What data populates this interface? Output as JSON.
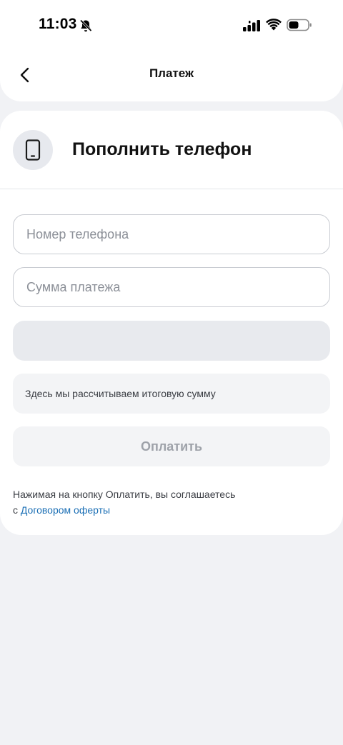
{
  "status_bar": {
    "time": "11:03",
    "icons": [
      "bell-off-icon",
      "signal-icon",
      "wifi-icon",
      "battery-icon"
    ]
  },
  "nav": {
    "back_icon": "chevron-left-icon",
    "title": "Платеж"
  },
  "header": {
    "icon": "smartphone-icon",
    "title": "Пополнить телефон"
  },
  "form": {
    "phone_placeholder": "Номер телефона",
    "phone_value": "",
    "amount_placeholder": "Сумма платежа",
    "amount_value": "",
    "summary_text": "Здесь мы рассчитываем итоговую сумму",
    "pay_label": "Оплатить"
  },
  "terms": {
    "text_line1": "Нажимая на кнопку Оплатить, вы соглашаетесь",
    "text_prefix": "с ",
    "link_text": "Договором оферты"
  },
  "colors": {
    "background": "#f1f2f5",
    "card": "#ffffff",
    "link": "#1b6fb5",
    "disabled_text": "#9ea2a9"
  }
}
